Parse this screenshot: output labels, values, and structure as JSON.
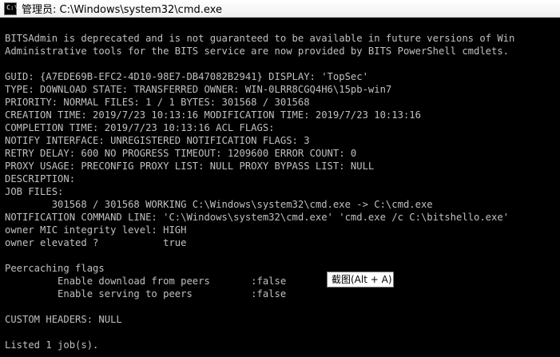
{
  "window": {
    "title": "管理员: C:\\Windows\\system32\\cmd.exe",
    "icon": "cmd-icon",
    "icon_glyph": "C:\\"
  },
  "console": {
    "lines": [
      "BITSAdmin is deprecated and is not guaranteed to be available in future versions of Win",
      "Administrative tools for the BITS service are now provided by BITS PowerShell cmdlets.",
      "",
      "GUID: {A7EDE69B-EFC2-4D10-98E7-DB47082B2941} DISPLAY: 'TopSec'",
      "TYPE: DOWNLOAD STATE: TRANSFERRED OWNER: WIN-0LRR8CGQ4H6\\15pb-win7",
      "PRIORITY: NORMAL FILES: 1 / 1 BYTES: 301568 / 301568",
      "CREATION TIME: 2019/7/23 10:13:16 MODIFICATION TIME: 2019/7/23 10:13:16",
      "COMPLETION TIME: 2019/7/23 10:13:16 ACL FLAGS:",
      "NOTIFY INTERFACE: UNREGISTERED NOTIFICATION FLAGS: 3",
      "RETRY DELAY: 600 NO PROGRESS TIMEOUT: 1209600 ERROR COUNT: 0",
      "PROXY USAGE: PRECONFIG PROXY LIST: NULL PROXY BYPASS LIST: NULL",
      "DESCRIPTION:",
      "JOB FILES:",
      "        301568 / 301568 WORKING C:\\Windows\\system32\\cmd.exe -> C:\\cmd.exe",
      "NOTIFICATION COMMAND LINE: 'C:\\Windows\\system32\\cmd.exe' 'cmd.exe /c C:\\bitshello.exe'",
      "owner MIC integrity level: HIGH",
      "owner elevated ?           true",
      "",
      "Peercaching flags",
      "         Enable download from peers       :false",
      "         Enable serving to peers          :false",
      "",
      "CUSTOM HEADERS: NULL",
      "",
      "Listed 1 job(s)."
    ]
  },
  "tooltip": {
    "text": "截图(Alt + A)"
  }
}
